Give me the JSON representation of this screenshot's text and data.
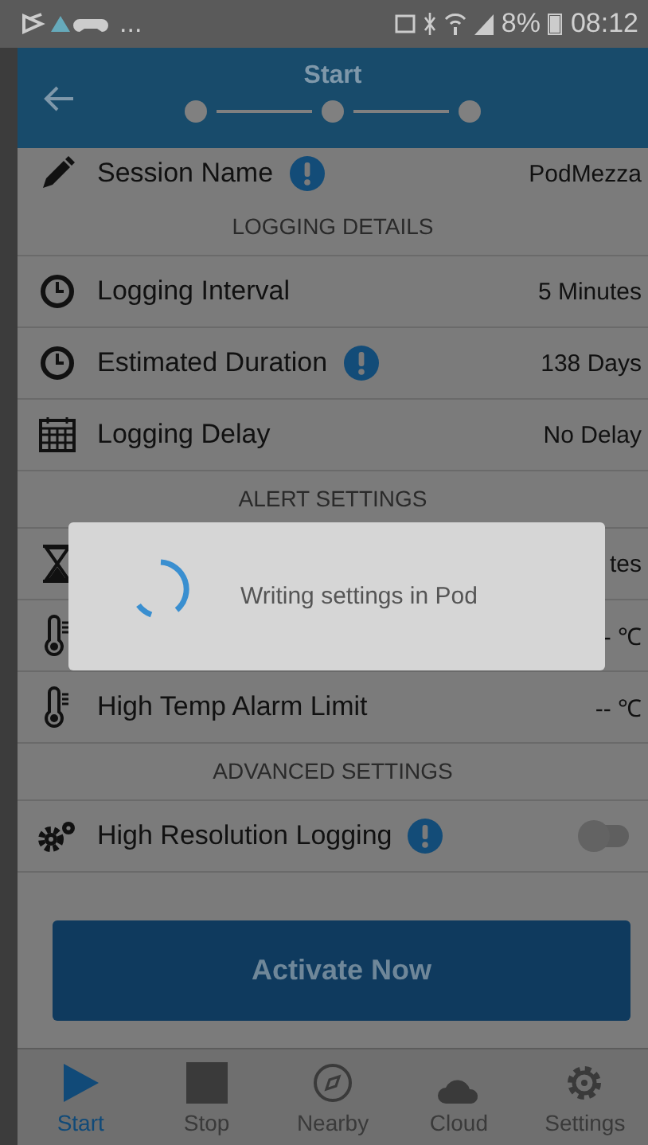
{
  "status_bar": {
    "overflow": "...",
    "battery": "8%",
    "time": "08:12"
  },
  "header": {
    "title": "Start"
  },
  "items": [
    {
      "kind": "setting",
      "label": "Session Name",
      "info": true,
      "value": "PodMezza"
    },
    {
      "kind": "section",
      "label": "LOGGING DETAILS"
    },
    {
      "kind": "setting",
      "label": "Logging Interval",
      "info": false,
      "value": "5 Minutes"
    },
    {
      "kind": "setting",
      "label": "Estimated Duration",
      "info": true,
      "value": "138 Days"
    },
    {
      "kind": "setting",
      "label": "Logging Delay",
      "info": false,
      "value": "No Delay"
    },
    {
      "kind": "section",
      "label": "ALERT SETTINGS"
    },
    {
      "kind": "setting",
      "value": "tes"
    },
    {
      "kind": "setting",
      "value": "- ℃"
    },
    {
      "kind": "setting",
      "label": "High Temp Alarm Limit",
      "info": false,
      "value": "-- ℃"
    },
    {
      "kind": "section",
      "label": "ADVANCED SETTINGS"
    },
    {
      "kind": "toggle",
      "label": "High Resolution Logging",
      "info": true,
      "on": false
    }
  ],
  "activate_button": "Activate Now",
  "dialog": {
    "message": "Writing settings in Pod"
  },
  "nav": [
    {
      "label": "Start",
      "selected": true
    },
    {
      "label": "Stop",
      "selected": false
    },
    {
      "label": "Nearby",
      "selected": false
    },
    {
      "label": "Cloud",
      "selected": false
    },
    {
      "label": "Settings",
      "selected": false
    }
  ]
}
